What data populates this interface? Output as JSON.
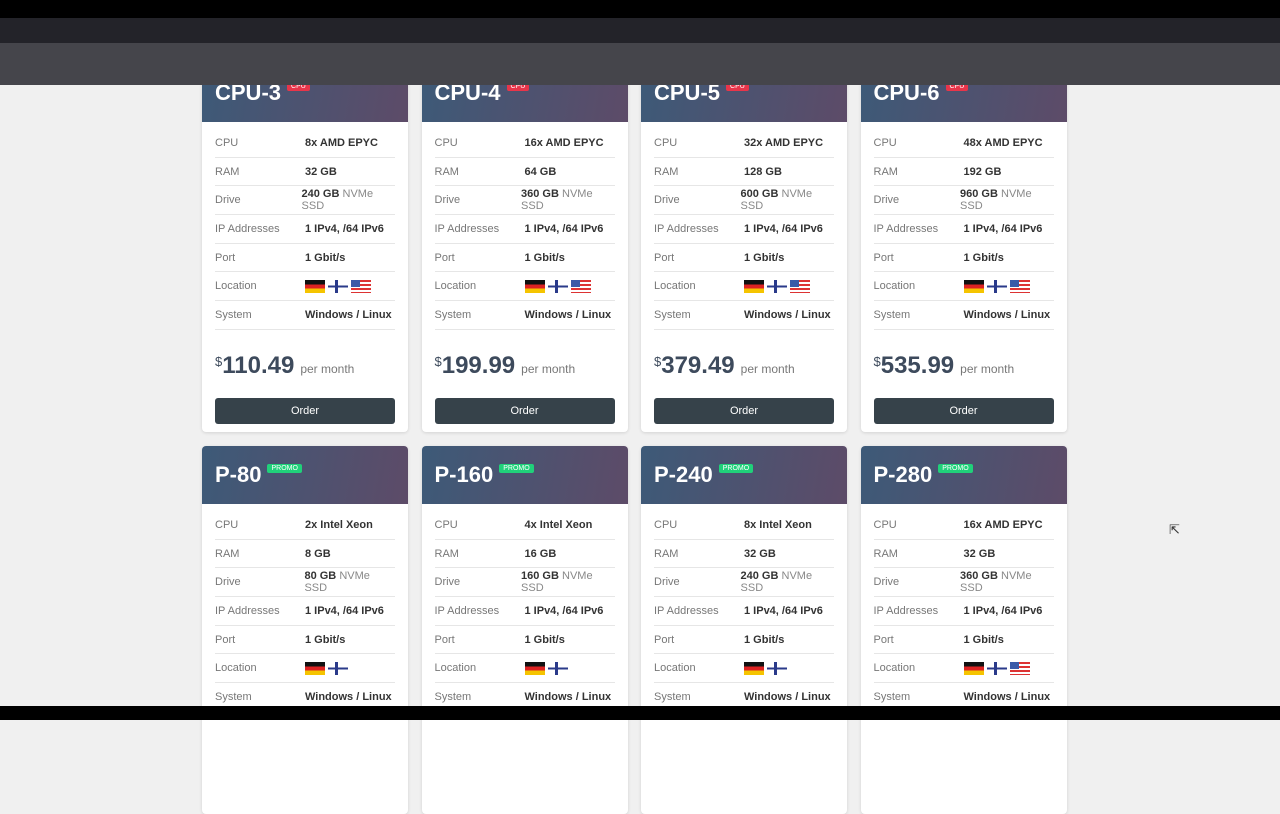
{
  "labels": {
    "cpu": "CPU",
    "ram": "RAM",
    "drive": "Drive",
    "ip": "IP Addresses",
    "port": "Port",
    "location": "Location",
    "system": "System",
    "per_month": "per month",
    "order": "Order",
    "currency": "$",
    "drive_suffix": "NVMe SSD"
  },
  "plans": [
    {
      "name": "CPU-3",
      "badge": "CPU",
      "badge_type": "cpu",
      "cpu": "8x AMD EPYC",
      "ram": "32 GB",
      "drive": "240 GB",
      "ip": "1 IPv4, /64 IPv6",
      "port": "1 Gbit/s",
      "locations": [
        "de",
        "fi",
        "us"
      ],
      "system": "Windows / Linux",
      "price": "110.49"
    },
    {
      "name": "CPU-4",
      "badge": "CPU",
      "badge_type": "cpu",
      "cpu": "16x AMD EPYC",
      "ram": "64 GB",
      "drive": "360 GB",
      "ip": "1 IPv4, /64 IPv6",
      "port": "1 Gbit/s",
      "locations": [
        "de",
        "fi",
        "us"
      ],
      "system": "Windows / Linux",
      "price": "199.99"
    },
    {
      "name": "CPU-5",
      "badge": "CPU",
      "badge_type": "cpu",
      "cpu": "32x AMD EPYC",
      "ram": "128 GB",
      "drive": "600 GB",
      "ip": "1 IPv4, /64 IPv6",
      "port": "1 Gbit/s",
      "locations": [
        "de",
        "fi",
        "us"
      ],
      "system": "Windows / Linux",
      "price": "379.49"
    },
    {
      "name": "CPU-6",
      "badge": "CPU",
      "badge_type": "cpu",
      "cpu": "48x AMD EPYC",
      "ram": "192 GB",
      "drive": "960 GB",
      "ip": "1 IPv4, /64 IPv6",
      "port": "1 Gbit/s",
      "locations": [
        "de",
        "fi",
        "us"
      ],
      "system": "Windows / Linux",
      "price": "535.99"
    },
    {
      "name": "P-80",
      "badge": "PROMO",
      "badge_type": "promo",
      "cpu": "2x Intel Xeon",
      "ram": "8 GB",
      "drive": "80 GB",
      "ip": "1 IPv4, /64 IPv6",
      "port": "1 Gbit/s",
      "locations": [
        "de",
        "fi"
      ],
      "system": "Windows / Linux"
    },
    {
      "name": "P-160",
      "badge": "PROMO",
      "badge_type": "promo",
      "cpu": "4x Intel Xeon",
      "ram": "16 GB",
      "drive": "160 GB",
      "ip": "1 IPv4, /64 IPv6",
      "port": "1 Gbit/s",
      "locations": [
        "de",
        "fi"
      ],
      "system": "Windows / Linux"
    },
    {
      "name": "P-240",
      "badge": "PROMO",
      "badge_type": "promo",
      "cpu": "8x Intel Xeon",
      "ram": "32 GB",
      "drive": "240 GB",
      "ip": "1 IPv4, /64 IPv6",
      "port": "1 Gbit/s",
      "locations": [
        "de",
        "fi"
      ],
      "system": "Windows / Linux"
    },
    {
      "name": "P-280",
      "badge": "PROMO",
      "badge_type": "promo",
      "cpu": "16x AMD EPYC",
      "ram": "32 GB",
      "drive": "360 GB",
      "ip": "1 IPv4, /64 IPv6",
      "port": "1 Gbit/s",
      "locations": [
        "de",
        "fi",
        "us"
      ],
      "system": "Windows / Linux"
    }
  ]
}
